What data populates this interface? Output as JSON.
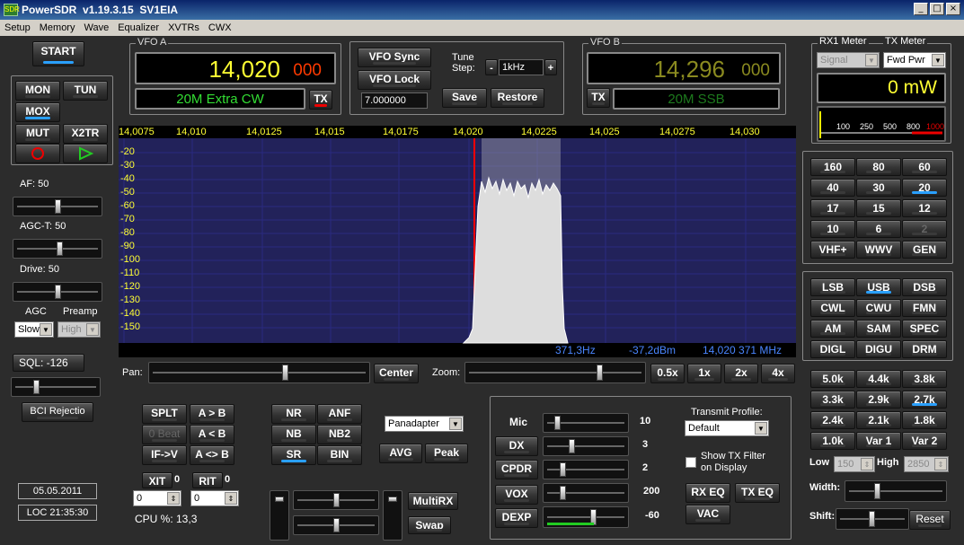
{
  "title": "PowerSDR  v1.19.3.15  SV1EIA",
  "menu": [
    "Setup",
    "Memory",
    "Wave",
    "Equalizer",
    "XVTRs",
    "CWX"
  ],
  "start": "START",
  "mode_btns": [
    "MON",
    "TUN",
    "MOX",
    "MUT",
    "X2TR"
  ],
  "af": "AF:  50",
  "agct": "AGC-T:  50",
  "drive": "Drive:  50",
  "agc": "AGC",
  "preamp": "Preamp",
  "agc_val": "Slow",
  "preamp_val": "High",
  "sql": "SQL:  -126",
  "bci": "BCI Rejectio",
  "date": "05.05.2011",
  "loc": "LOC 21:35:30",
  "vfoa": {
    "label": "VFO A",
    "freq": "14,020",
    "sub": "000",
    "band": "20M Extra CW",
    "tx": "TX"
  },
  "vfob": {
    "label": "VFO B",
    "freq": "14,296",
    "sub": "000",
    "band": "20M SSB",
    "tx": "TX"
  },
  "mid": {
    "sync": "VFO Sync",
    "lock": "VFO Lock",
    "tune": "Tune",
    "step": "Step:",
    "step_val": "1kHz",
    "minus": "-",
    "plus": "+",
    "val": "7.000000",
    "save": "Save",
    "restore": "Restore"
  },
  "meter": {
    "rx": "RX1 Meter",
    "tx": "TX Meter",
    "rx_sel": "Signal",
    "tx_sel": "Fwd Pwr",
    "reading": "0 mW",
    "scale": [
      "100",
      "250",
      "500",
      "800",
      "1000"
    ]
  },
  "freq_ticks": [
    "14,0075",
    "14,010",
    "14,0125",
    "14,015",
    "14,0175",
    "14,020",
    "14,0225",
    "14,025",
    "14,0275",
    "14,030"
  ],
  "db_ticks": [
    "-20",
    "-30",
    "-40",
    "-50",
    "-60",
    "-70",
    "-80",
    "-90",
    "-100",
    "-110",
    "-120",
    "-130",
    "-140",
    "-150"
  ],
  "readout": {
    "hz": "371,3Hz",
    "dbm": "-37,2dBm",
    "mhz": "14,020 371 MHz"
  },
  "pan": "Pan:",
  "center": "Center",
  "zoom": "Zoom:",
  "zooms": [
    "0.5x",
    "1x",
    "2x",
    "4x"
  ],
  "bands": [
    "160",
    "80",
    "60",
    "40",
    "30",
    "20",
    "17",
    "15",
    "12",
    "10",
    "6",
    "2",
    "VHF+",
    "WWV",
    "GEN"
  ],
  "modes": [
    "LSB",
    "USB",
    "DSB",
    "CWL",
    "CWU",
    "FMN",
    "AM",
    "SAM",
    "SPEC",
    "DIGL",
    "DIGU",
    "DRM"
  ],
  "filters": [
    "5.0k",
    "4.4k",
    "3.8k",
    "3.3k",
    "2.9k",
    "2.7k",
    "2.4k",
    "2.1k",
    "1.8k",
    "1.0k",
    "Var 1",
    "Var 2"
  ],
  "low": "Low",
  "high": "High",
  "low_val": "150",
  "high_val": "2850",
  "width": "Width:",
  "shift": "Shift:",
  "reset": "Reset",
  "vfo_btns": [
    "SPLT",
    "A > B",
    "0 Beat",
    "A < B",
    "IF->V",
    "A <> B"
  ],
  "xit": "XIT",
  "xit_v": "0",
  "rit": "RIT",
  "rit_v": "0",
  "xit_spin": "0",
  "rit_spin": "0",
  "cpu": "CPU %: 13,3",
  "dsp": [
    "NR",
    "ANF",
    "NB",
    "NB2",
    "SR",
    "BIN"
  ],
  "panad": "Panadapter",
  "avg": "AVG",
  "peak": "Peak",
  "multirx": "MultiRX",
  "swap": "Swap",
  "tx": {
    "rows": [
      "Mic",
      "DX",
      "CPDR",
      "VOX",
      "DEXP"
    ],
    "vals": [
      "10",
      "3",
      "2",
      "200",
      "-60"
    ],
    "profile": "Transmit Profile:",
    "profile_val": "Default",
    "show": "Show TX Filter",
    "show2": "on Display",
    "rxeq": "RX EQ",
    "txeq": "TX EQ",
    "vac": "VAC"
  },
  "colors": {
    "lcd_yellow": "#ffff33",
    "lcd_green": "#33dd33",
    "accent": "#2aa0ff",
    "grid": "#2a2a80"
  }
}
